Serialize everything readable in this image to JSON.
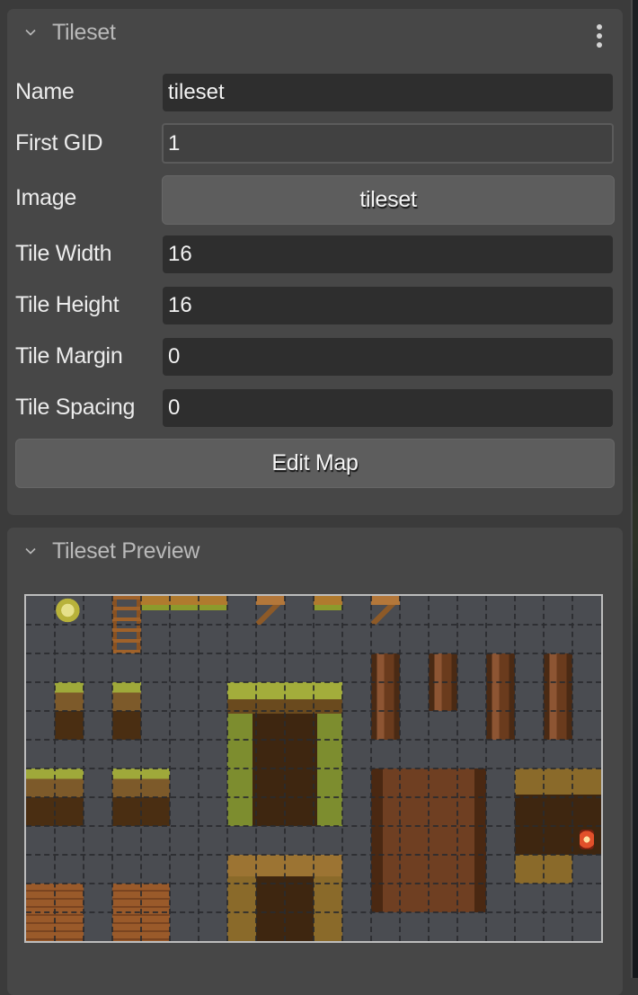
{
  "tileset_panel": {
    "title": "Tileset",
    "menu_icon": "kebab-menu-icon",
    "collapse_icon": "chevron-down-icon",
    "fields": [
      {
        "label": "Name",
        "value": "tileset",
        "type": "text"
      },
      {
        "label": "First GID",
        "value": "1",
        "type": "readonly"
      },
      {
        "label": "Image",
        "value": "tileset",
        "type": "button"
      },
      {
        "label": "Tile Width",
        "value": "16",
        "type": "number"
      },
      {
        "label": "Tile Height",
        "value": "16",
        "type": "number"
      },
      {
        "label": "Tile Margin",
        "value": "0",
        "type": "number"
      },
      {
        "label": "Tile Spacing",
        "value": "0",
        "type": "number"
      }
    ],
    "edit_map_label": "Edit Map"
  },
  "preview_panel": {
    "title": "Tileset Preview",
    "collapse_icon": "chevron-down-icon",
    "grid": {
      "columns": 20,
      "rows": 12
    },
    "tiles": [
      {
        "name": "yellow-sprite",
        "col": 1,
        "row": 0,
        "w": 1,
        "h": 1,
        "kind": "leaf"
      },
      {
        "name": "ladder",
        "col": 3,
        "row": 0,
        "w": 1,
        "h": 2,
        "kind": "ladder"
      },
      {
        "name": "log-beam",
        "col": 4,
        "row": 0,
        "w": 3,
        "h": 1,
        "kind": "log"
      },
      {
        "name": "bracket",
        "col": 8,
        "row": 0,
        "w": 1,
        "h": 1,
        "kind": "bracket"
      },
      {
        "name": "small-log",
        "col": 10,
        "row": 0,
        "w": 1,
        "h": 1,
        "kind": "log"
      },
      {
        "name": "bracket",
        "col": 12,
        "row": 0,
        "w": 1,
        "h": 1,
        "kind": "bracket"
      },
      {
        "name": "grass-pillar",
        "col": 1,
        "row": 3,
        "w": 1,
        "h": 2,
        "kind": "grass"
      },
      {
        "name": "grass-pillar",
        "col": 3,
        "row": 3,
        "w": 1,
        "h": 2,
        "kind": "grass"
      },
      {
        "name": "wood-post",
        "col": 12,
        "row": 2,
        "w": 1,
        "h": 3,
        "kind": "post"
      },
      {
        "name": "wood-post-short",
        "col": 14,
        "row": 2,
        "w": 1,
        "h": 2,
        "kind": "post"
      },
      {
        "name": "wood-post",
        "col": 16,
        "row": 2,
        "w": 1,
        "h": 3,
        "kind": "post"
      },
      {
        "name": "wood-post",
        "col": 18,
        "row": 2,
        "w": 1,
        "h": 3,
        "kind": "post"
      },
      {
        "name": "vine-cave-block",
        "col": 7,
        "row": 3,
        "w": 4,
        "h": 5,
        "kind": "cave"
      },
      {
        "name": "hill-left",
        "col": 0,
        "row": 6,
        "w": 2,
        "h": 2,
        "kind": "grass"
      },
      {
        "name": "hill-right",
        "col": 3,
        "row": 6,
        "w": 2,
        "h": 2,
        "kind": "grass"
      },
      {
        "name": "wooden-door",
        "col": 12,
        "row": 6,
        "w": 4,
        "h": 5,
        "kind": "door"
      },
      {
        "name": "cave-wall-lantern",
        "col": 17,
        "row": 6,
        "w": 3,
        "h": 3,
        "kind": "wall"
      },
      {
        "name": "rock-ledge",
        "col": 17,
        "row": 9,
        "w": 2,
        "h": 1,
        "kind": "rock"
      },
      {
        "name": "rock-arch",
        "col": 7,
        "row": 9,
        "w": 4,
        "h": 3,
        "kind": "arch"
      },
      {
        "name": "brick-statue",
        "col": 0,
        "row": 10,
        "w": 2,
        "h": 2,
        "kind": "brick"
      },
      {
        "name": "brick-frame",
        "col": 3,
        "row": 10,
        "w": 2,
        "h": 2,
        "kind": "brick"
      }
    ]
  }
}
